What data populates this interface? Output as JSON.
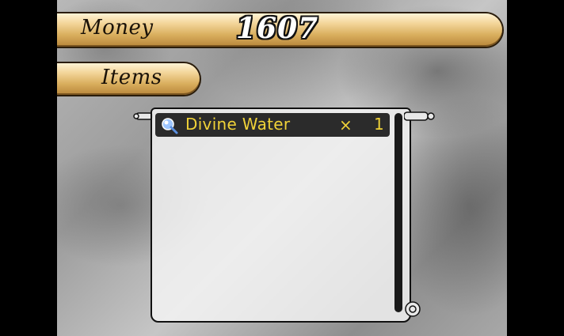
{
  "money": {
    "label": "Money",
    "value": "1607"
  },
  "items_tab": {
    "label": "Items"
  },
  "inventory": [
    {
      "name": "Divine Water",
      "times": "×",
      "quantity": "1",
      "icon": "gem-icon"
    }
  ],
  "colors": {
    "bar_light": "#f3d59a",
    "bar_dark": "#b8863a",
    "item_text": "#f0d238",
    "item_row_bg": "#2b2b2b"
  }
}
